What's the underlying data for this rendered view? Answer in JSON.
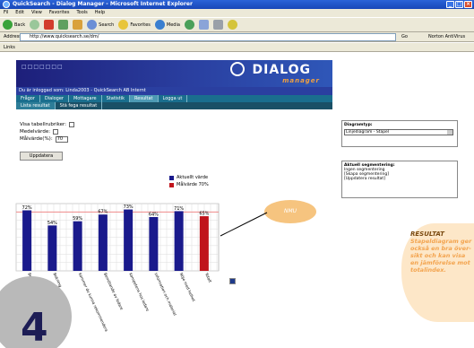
{
  "browser": {
    "title": "QuickSearch - Dialog Manager - Microsoft Internet Explorer",
    "menu": [
      "Fil",
      "Edit",
      "View",
      "Favorites",
      "Tools",
      "Help"
    ],
    "toolbar": {
      "back": "Back",
      "search": "Search",
      "favorites": "Favorites",
      "media": "Media"
    },
    "address_label": "Address",
    "address_value": "http://www.quicksearch.se/dm/",
    "go_label": "Go",
    "links_label": "Norton AntiVirus",
    "links_bar": "Links"
  },
  "app": {
    "brand_squares": "□□□□□□□",
    "logo": "DIALOG",
    "logo_sub": "manager",
    "logged_in": "Du är inloggad som: Linda2003 - QuickSearch AB Internt",
    "nav_tabs": [
      "Frågor",
      "Dialoger",
      "Mottagare",
      "Statistik",
      "Resultat",
      "Logga ut"
    ],
    "nav_active": 4,
    "sub_tabs": [
      "Lista resultat",
      "Stä fega resultat"
    ],
    "sub_active": 0
  },
  "options": {
    "show_labels": "Visa tabellrubriker:",
    "average": "Medelvärde:",
    "target": "Målvärde(%):",
    "target_value": "70",
    "update_button": "Uppdatera"
  },
  "legend": {
    "series1": "Aktuellt värde",
    "series2": "Målvärde 70%"
  },
  "colors": {
    "series1": "#1a1a8c",
    "series2": "#c0141c",
    "target_line": "#f08a8a",
    "callout": "#f6c47f"
  },
  "chart_data": {
    "type": "bar",
    "categories": [
      "Bemötande",
      "Bokning",
      "Kommer du kunna rekommendera",
      "Bemötande av ledare",
      "Kompetens hos ledare",
      "Information och material",
      "Nöje med helhet",
      "Totalt"
    ],
    "values": [
      72,
      54,
      59,
      67,
      73,
      64,
      71,
      65
    ],
    "value_labels": [
      "72%",
      "54%",
      "59%",
      "67%",
      "73%",
      "64%",
      "71%",
      "65%"
    ],
    "highlight_index": 7,
    "target": 70,
    "ylim": [
      0,
      80
    ],
    "grid": true,
    "legend_position": "top-right"
  },
  "callout": {
    "text": "NMU"
  },
  "sidebar": {
    "chart_type_label": "Diagramtyp:",
    "chart_type_value": "Linjediagram - Stapel",
    "current_segment_label": "Aktuell segmentering:",
    "current_segment_lines": [
      "Ingen segmentering",
      "[Skapa segmentering]",
      "[Uppdatera resultat]"
    ]
  },
  "result_box": {
    "title": "RESULTAT",
    "body": "Stapeldiagram ger också en bra över-sikt och kan visa en jämförelse mot totalindex."
  },
  "slide_number": "4"
}
